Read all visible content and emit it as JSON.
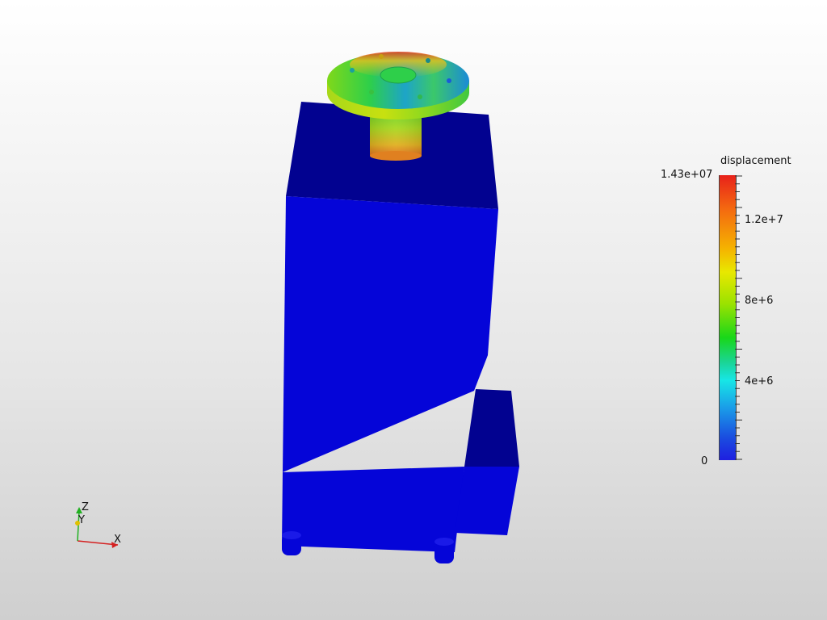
{
  "legend": {
    "title": "displacement",
    "max_label": "1.43e+07",
    "tick_labels": [
      "1.2e+7",
      "8e+6",
      "4e+6"
    ],
    "min_label": "0",
    "colors": {
      "high": "#e8211a",
      "mid_high": "#f5b400",
      "mid": "#19d719",
      "mid_low": "#17e6e6",
      "low": "#1f1fe0"
    }
  },
  "axes": {
    "x_label": "X",
    "y_label": "Y",
    "z_label": "Z",
    "x_color": "#d42020",
    "y_color": "#e0c000",
    "z_color": "#20b020"
  },
  "model": {
    "body_color": "#0505d8",
    "body_top_color": "#020290"
  }
}
